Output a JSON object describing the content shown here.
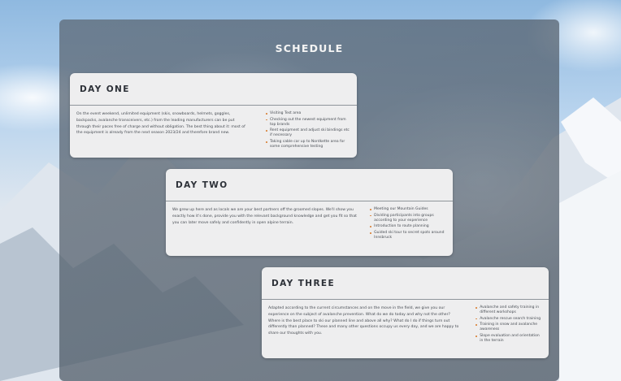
{
  "page": {
    "title": "SCHEDULE"
  },
  "days": [
    {
      "title": "DAY ONE",
      "description": "On the event weekend, unlimited equipment (skis, snowboards, helmets, goggles, backpacks, avalanche transceivers, etc.) from the leading manufacturers can be put through their paces free of charge and without obligation. The best thing about it: most of the equipment is already from the next season 2023/24 and therefore brand new.",
      "items": [
        "Visiting Test area",
        "Checking out the newest equipment from top brands",
        "Rent equipment and adjust ski bindings etc if necessary",
        "Taking cable car up to Nordkette area for some comprehensive testing"
      ]
    },
    {
      "title": "DAY TWO",
      "description": "We grew up here and as locals we are your best partners off the groomed slopes. We'll show you exactly how it's done, provide you with the relevant background knowledge and get you fit so that you can later move safely and confidently in open alpine terrain.",
      "items": [
        "Meeting our Mountain Guides",
        "Dividing participants into groups according to your experience",
        "Introduction to route planning",
        "Guided ski tour to secret spots around Innsbruck"
      ]
    },
    {
      "title": "DAY THREE",
      "description": "Adapted according to the current circumstances and on the move in the field, we give you our experience on the subject of avalanche prevention. What do we do today and why not the other? Where is the best place to ski our planned line and above all why? What do I do if things turn out differently than planned? These and many other questions occupy us every day, and we are happy to share our thoughts with you.",
      "items": [
        "Avalanche and safety training in different workshops",
        "Avalanche rescue search training",
        "Training in snow and avalanche awareness",
        "Slope evaluation and orientation in the terrain"
      ]
    }
  ],
  "colors": {
    "panel": "#4e5a68",
    "card": "#eeeeef",
    "bullet": "#d9833a",
    "text": "#474c53"
  }
}
